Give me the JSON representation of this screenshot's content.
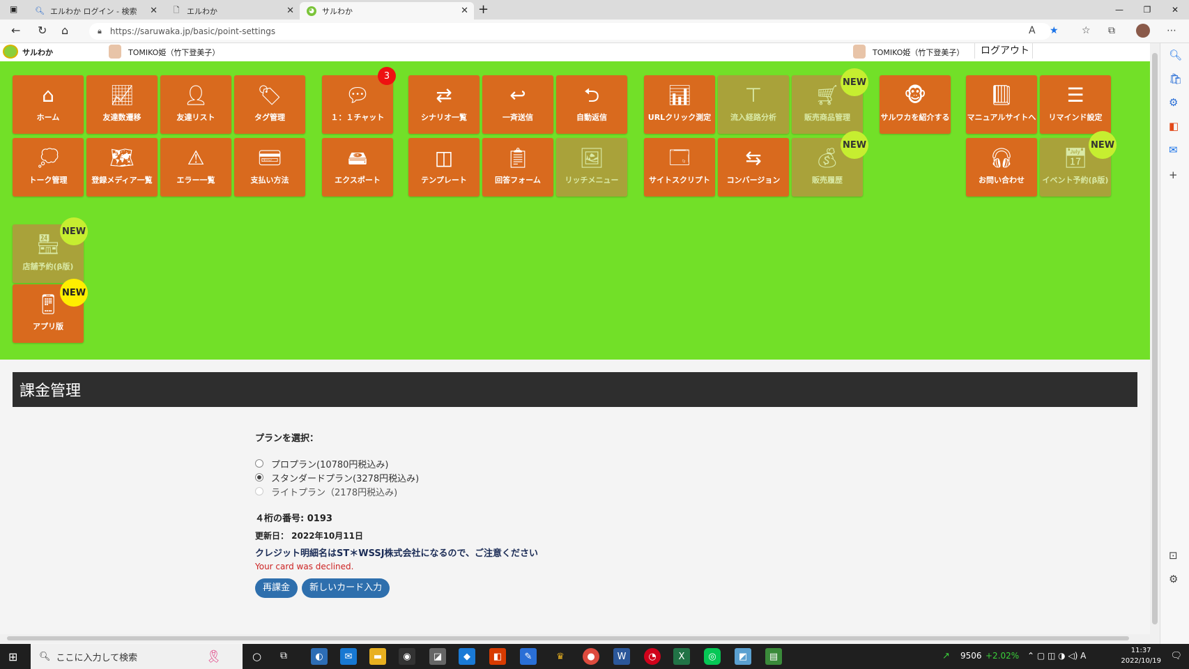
{
  "tabs": [
    {
      "title": "エルわか ログイン - 検索",
      "icon": "search-icon"
    },
    {
      "title": "エルわか",
      "icon": "page-icon"
    },
    {
      "title": "サルわか",
      "icon": "monkey-favicon"
    }
  ],
  "address": {
    "url": "https://saruwaka.jp/basic/point-settings"
  },
  "header": {
    "brand": "サルわか",
    "user_left": "TOMIKO姫（竹下登美子）",
    "user_right": "TOMIKO姫（竹下登美子）",
    "logout": "ログアウト"
  },
  "menu": {
    "home": "ホーム",
    "friends_trend": "友達数遷移",
    "friends_list": "友達リスト",
    "tags": "タグ管理",
    "chat": "１：１チャット",
    "chat_badge": "3",
    "scenario": "シナリオ一覧",
    "broadcast": "一斉送信",
    "auto_reply": "自動返信",
    "url_click": "URLクリック測定",
    "inflow": "流入経路分析",
    "products": "販売商品管理",
    "introduce": "サルワカを紹介する",
    "manual": "マニュアルサイトへ",
    "remind": "リマインド設定",
    "talk": "トーク管理",
    "media": "登録メディア一覧",
    "errors": "エラー一覧",
    "payment": "支払い方法",
    "export": "エクスポート",
    "template": "テンプレート",
    "answer_form": "回答フォーム",
    "rich_menu": "リッチメニュー",
    "site_script": "サイトスクリプト",
    "conversion": "コンバージョン",
    "sales_history": "販売履歴",
    "contact": "お問い合わせ",
    "event": "イベント予約(β版)",
    "store": "店舗予約(β版)",
    "app": "アプリ版",
    "new_badge": "NEW"
  },
  "section": {
    "title": "課金管理"
  },
  "form": {
    "plan_label": "プランを選択：",
    "plans": [
      "プロプラン(10780円税込み)",
      "スタンダードプラン(3278円税込み)",
      "ライトプラン（2178円税込み)"
    ],
    "selected_plan": "スタンダードプラン(3278円税込み)",
    "card_digits": "４桁の番号: 0193",
    "updated": "更新日： 2022年10月11日",
    "notice": "クレジット明細名はST＊WSSJ株式会社になるので、ご注意ください",
    "error": "Your card was declined.",
    "btn_recharge": "再課金",
    "btn_new_card": "新しいカード入力"
  },
  "taskbar": {
    "search_placeholder": "ここに入力して検索",
    "stock": "9506",
    "stock_change": "+2.02%",
    "time": "11:37",
    "date": "2022/10/19"
  },
  "colors": {
    "menu_bg": "#72e028",
    "tile": "#d96a1e",
    "tile_disabled": "#a9a23a",
    "header": "#2e2e2e",
    "button": "#2e6fad",
    "error": "#cc2222"
  }
}
